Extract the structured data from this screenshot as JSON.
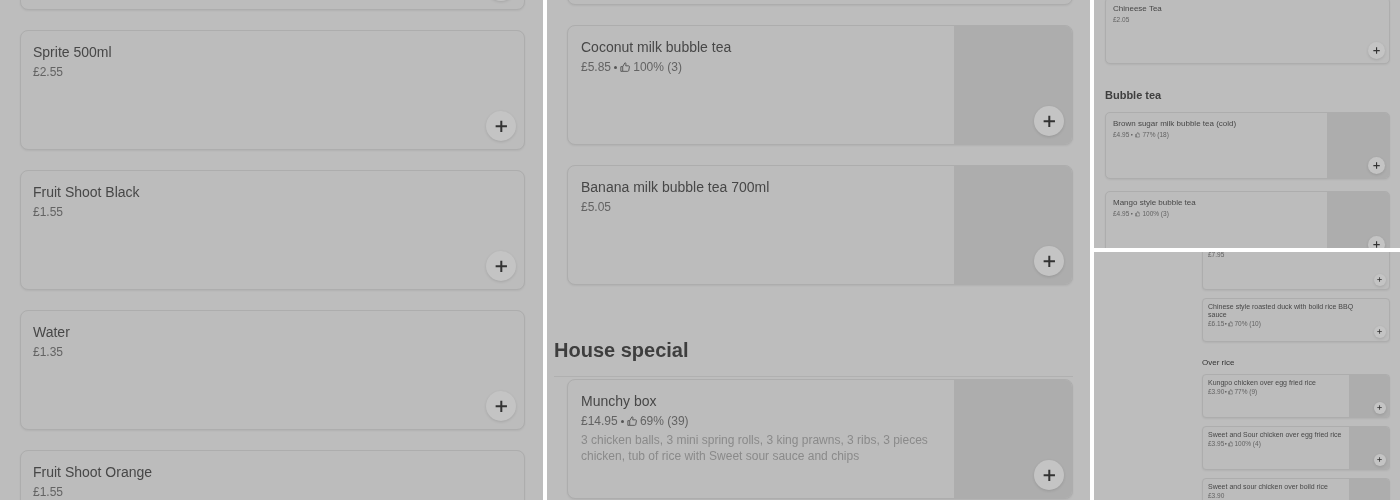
{
  "panels": [
    {
      "items": [
        {
          "kind": "card_edge"
        },
        {
          "kind": "card",
          "name": "Sprite 500ml",
          "price": "£2.55",
          "has_image": false
        },
        {
          "kind": "card",
          "name": "Fruit Shoot Black",
          "price": "£1.55",
          "has_image": false
        },
        {
          "kind": "card",
          "name": "Water",
          "price": "£1.35",
          "has_image": false
        },
        {
          "kind": "card",
          "name": "Fruit Shoot Orange",
          "price": "£1.55",
          "has_image": false
        }
      ]
    },
    {
      "items": [
        {
          "kind": "card_edge"
        },
        {
          "kind": "card",
          "name": "Coconut milk bubble tea",
          "price": "£5.85",
          "rating": "100% (3)",
          "has_image": true
        },
        {
          "kind": "card",
          "name": "Banana milk bubble tea 700ml",
          "price": "£5.05",
          "has_image": true
        },
        {
          "kind": "section",
          "title": "House special"
        },
        {
          "kind": "card",
          "name": "Munchy box",
          "price": "£14.95",
          "rating": "69% (39)",
          "description": "3 chicken balls, 3 mini spring rolls, 3 king prawns, 3 ribs, 3 pieces chicken, tub of rice with Sweet sour sauce and chips",
          "has_image": true
        }
      ]
    },
    {
      "items": [
        {
          "kind": "card",
          "name": "Chineese Tea",
          "price": "£2.05",
          "has_image": false
        },
        {
          "kind": "section",
          "title": "Bubble tea"
        },
        {
          "kind": "card",
          "name": "Brown sugar milk bubble tea (cold)",
          "price": "£4.95",
          "rating": "77% (18)",
          "has_image": true
        },
        {
          "kind": "card",
          "name": "Mango style bubble tea",
          "price": "£4.95",
          "rating": "100% (3)",
          "has_image": true
        }
      ]
    },
    {
      "items": [
        {
          "kind": "card",
          "price": "£7.95",
          "has_image": false
        },
        {
          "kind": "card",
          "name": "Chinese style roasted duck with boild rice BBQ sauce",
          "price": "£6.15",
          "rating": "70% (10)",
          "has_image": false
        },
        {
          "kind": "section",
          "title": "Over rice"
        },
        {
          "kind": "card",
          "name": "Kungpo chicken over egg fried rice",
          "price": "£3.90",
          "rating": "77% (9)",
          "has_image": true
        },
        {
          "kind": "card",
          "name": "Sweet and Sour chicken over egg fried rice",
          "price": "£3.95",
          "rating": "100% (4)",
          "has_image": true
        },
        {
          "kind": "card",
          "name": "Sweet and sour chicken over boild rice",
          "price": "£3.90",
          "has_image": true
        }
      ]
    }
  ]
}
